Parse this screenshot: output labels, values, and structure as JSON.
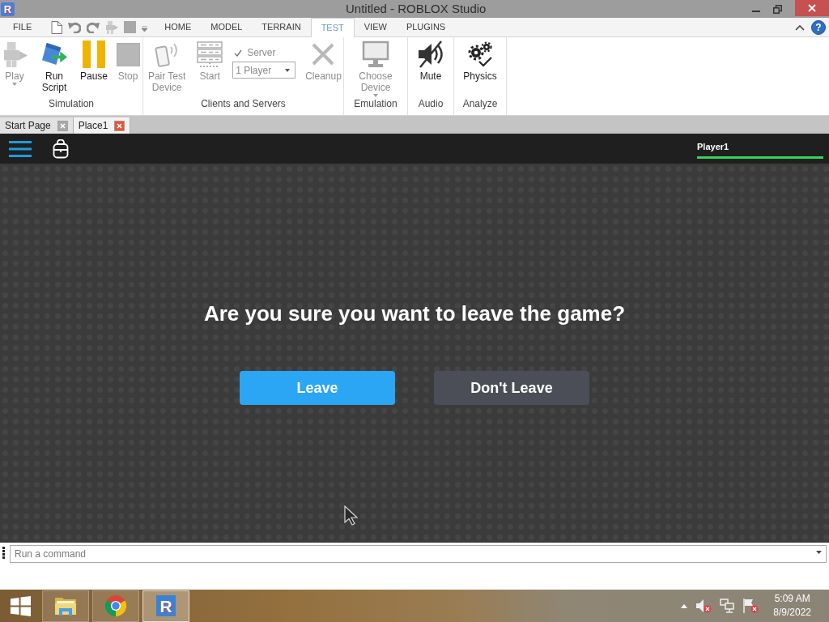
{
  "window": {
    "app_icon": "R",
    "title": "Untitled - ROBLOX Studio"
  },
  "ribbon": {
    "tabs": [
      {
        "kind": "menu",
        "label": "FILE",
        "selected": false
      },
      {
        "kind": "tab",
        "label": "HOME",
        "selected": false
      },
      {
        "kind": "tab",
        "label": "MODEL",
        "selected": false
      },
      {
        "kind": "tab",
        "label": "TERRAIN",
        "selected": false
      },
      {
        "kind": "tab",
        "label": "TEST",
        "selected": true
      },
      {
        "kind": "tab",
        "label": "VIEW",
        "selected": false
      },
      {
        "kind": "tab",
        "label": "PLUGINS",
        "selected": false
      }
    ],
    "help": "?",
    "groups": [
      {
        "label": "Simulation",
        "items": [
          {
            "kind": "button",
            "label": "Play",
            "disabled": true,
            "dropdown": true
          },
          {
            "kind": "button",
            "label": "Run Script",
            "disabled": false,
            "dropdown": false
          },
          {
            "kind": "button",
            "label": "Pause",
            "disabled": false,
            "dropdown": false
          },
          {
            "kind": "button",
            "label": "Stop",
            "disabled": true,
            "dropdown": false
          }
        ]
      },
      {
        "label": "Clients and Servers",
        "items": [
          {
            "kind": "button",
            "label": "Pair Test Device",
            "disabled": true,
            "dropdown": false
          },
          {
            "kind": "button",
            "label": "Start",
            "disabled": true,
            "dropdown": false
          },
          {
            "kind": "options",
            "checkbox": {
              "label": "Server",
              "checked": true
            },
            "select": {
              "value": "1 Player"
            }
          },
          {
            "kind": "button",
            "label": "Cleanup",
            "disabled": true,
            "dropdown": false
          }
        ]
      },
      {
        "label": "Emulation",
        "items": [
          {
            "kind": "button",
            "label": "Choose Device",
            "disabled": true,
            "dropdown": true
          }
        ]
      },
      {
        "label": "Audio",
        "items": [
          {
            "kind": "button",
            "label": "Mute",
            "disabled": false,
            "dropdown": false
          }
        ]
      },
      {
        "label": "Analyze",
        "items": [
          {
            "kind": "button",
            "label": "Physics",
            "disabled": false,
            "dropdown": false
          }
        ]
      }
    ]
  },
  "document_tabs": [
    {
      "label": "Start Page",
      "selected": false
    },
    {
      "label": "Place1",
      "selected": true
    }
  ],
  "game": {
    "player_name": "Player1",
    "health": {
      "level": 1
    },
    "dialog": {
      "message": "Are you sure you want to leave the game?",
      "buttons": [
        {
          "kind": "primary",
          "label": "Leave"
        },
        {
          "kind": "secondary",
          "label": "Don't Leave"
        }
      ]
    }
  },
  "command_bar": {
    "placeholder": "Run a command"
  },
  "taskbar": {
    "apps": [
      {
        "selected": false
      },
      {
        "selected": false
      },
      {
        "selected": true,
        "logo": "R"
      }
    ],
    "clock": {
      "time": "5:09 AM",
      "date": "8/9/2022"
    }
  }
}
